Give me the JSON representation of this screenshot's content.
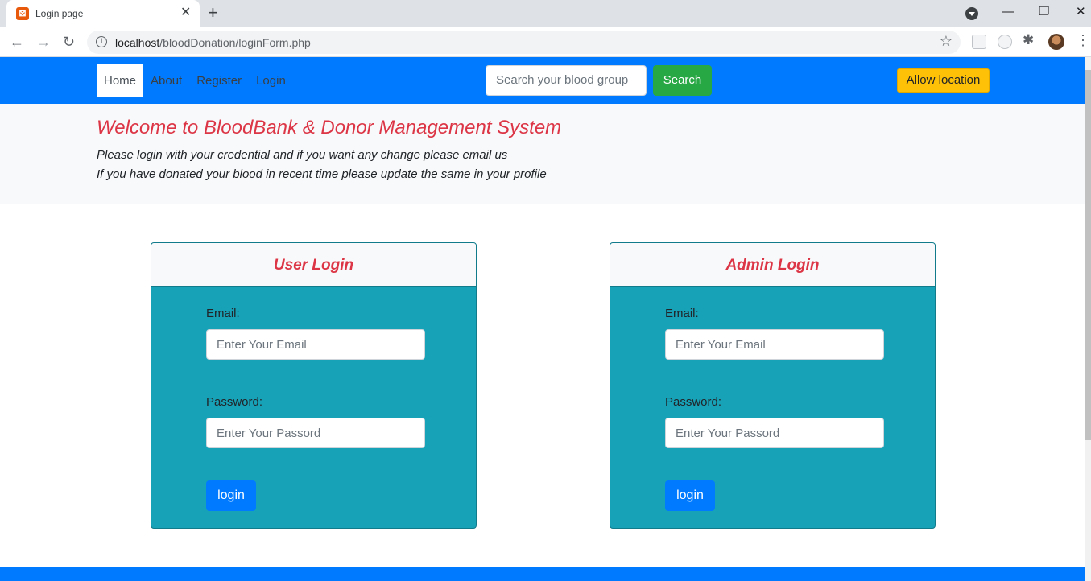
{
  "browser": {
    "tab_title": "Login page",
    "tab_close": "✕",
    "new_tab": "+",
    "url_host": "localhost",
    "url_path": "/bloodDonation/loginForm.php",
    "win_minimize": "—",
    "win_restore": "❐",
    "win_close": "✕"
  },
  "navbar": {
    "links": [
      "Home",
      "About",
      "Register",
      "Login"
    ],
    "search_placeholder": "Search your blood group",
    "search_button": "Search",
    "location_button": "Allow location",
    "color": "#007bff"
  },
  "welcome": {
    "title": "Welcome to BloodBank & Donor Management System",
    "line1": "Please login with your credential and if you want any change please email us",
    "line2": "If you have donated your blood in recent time please update the same in your profile"
  },
  "user_login": {
    "title": "User Login",
    "email_label": "Email:",
    "email_placeholder": "Enter Your Email",
    "password_label": "Password:",
    "password_placeholder": "Enter Your Passord",
    "button": "login"
  },
  "admin_login": {
    "title": "Admin Login",
    "email_label": "Email:",
    "email_placeholder": "Enter Your Email",
    "password_label": "Password:",
    "password_placeholder": "Enter Your Passord",
    "button": "login"
  },
  "colors": {
    "card_body": "#17a2b8",
    "title_red": "#dc3545",
    "search_green": "#28a745",
    "location_yellow": "#ffc107"
  }
}
